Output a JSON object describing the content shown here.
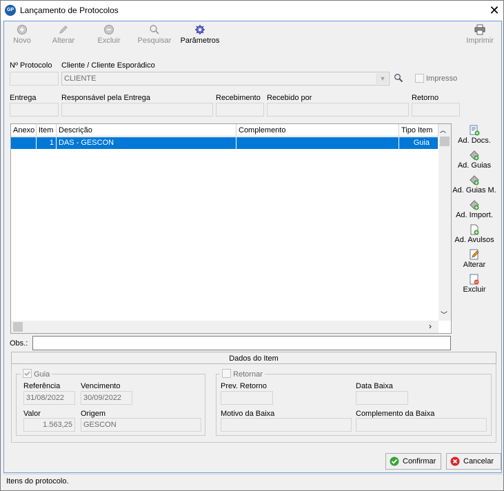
{
  "window": {
    "title": "Lançamento de Protocolos",
    "app_icon_text": "GP"
  },
  "toolbar": {
    "novo": "Novo",
    "alterar": "Alterar",
    "excluir": "Excluir",
    "pesquisar": "Pesquisar",
    "parametros": "Parâmetros",
    "imprimir": "Imprimir"
  },
  "header_form": {
    "protocolo_label": "Nº Protocolo",
    "cliente_label": "Cliente / Cliente Esporádico",
    "cliente_value": "CLIENTE",
    "impresso_label": "Impresso",
    "entrega_label": "Entrega",
    "responsavel_label": "Responsável pela Entrega",
    "recebimento_label": "Recebimento",
    "recebido_label": "Recebido por",
    "retorno_label": "Retorno"
  },
  "grid": {
    "columns": [
      "Anexo",
      "Item",
      "Descrição",
      "Complemento",
      "Tipo Item"
    ],
    "rows": [
      {
        "anexo": "",
        "item": "1",
        "descricao": "DAS - GESCON",
        "complemento": "",
        "tipo": "Guia"
      }
    ]
  },
  "side_actions": {
    "ad_docs": "Ad. Docs.",
    "ad_guias": "Ad. Guias",
    "ad_guias_m": "Ad. Guias M.",
    "ad_import": "Ad. Import.",
    "ad_avulsos": "Ad. Avulsos",
    "alterar": "Alterar",
    "excluir": "Excluir"
  },
  "obs": {
    "label": "Obs.:",
    "value": ""
  },
  "dados_item": {
    "title": "Dados do Item",
    "guia_label": "Guia",
    "referencia_label": "Referência",
    "referencia_value": "31/08/2022",
    "vencimento_label": "Vencimento",
    "vencimento_value": "30/09/2022",
    "valor_label": "Valor",
    "valor_value": "1.563,25",
    "origem_label": "Origem",
    "origem_value": "GESCON",
    "retornar_label": "Retornar",
    "prev_retorno_label": "Prev. Retorno",
    "data_baixa_label": "Data Baixa",
    "motivo_label": "Motivo da Baixa",
    "complemento_baixa_label": "Complemento da Baixa"
  },
  "footer": {
    "confirmar": "Confirmar",
    "cancelar": "Cancelar"
  },
  "status": {
    "text": "Itens do protocolo."
  },
  "colors": {
    "accent": "#0078d7",
    "confirm": "#3aa335",
    "cancel": "#d9262a"
  }
}
